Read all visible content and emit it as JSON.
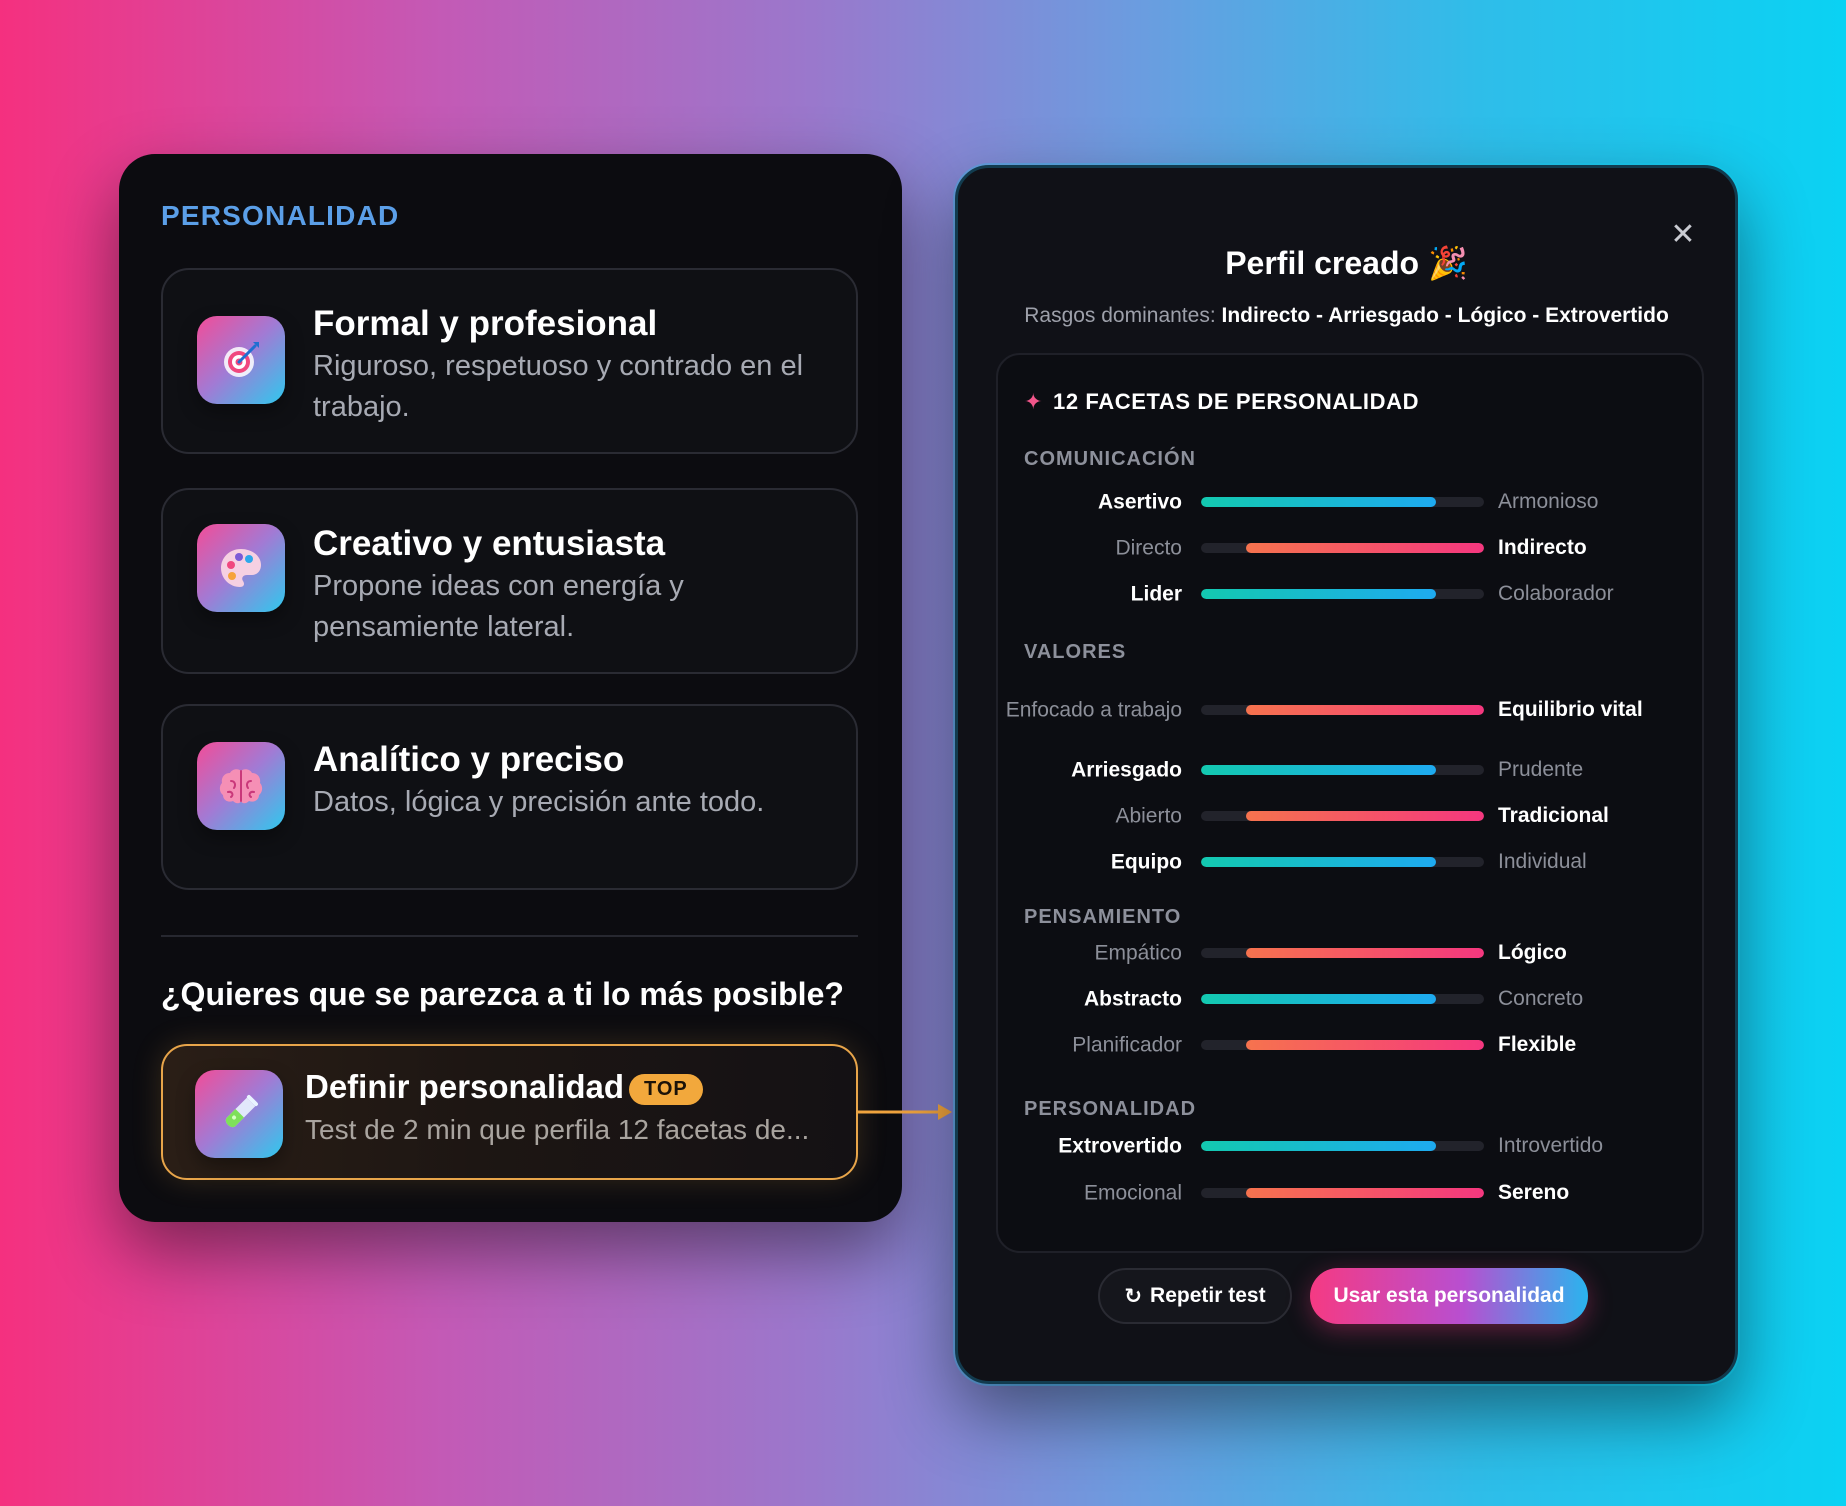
{
  "left_panel": {
    "title": "PERSONALIDAD",
    "options": [
      {
        "title": "Formal y profesional",
        "desc": "Riguroso, respetuoso y contrado en el trabajo.",
        "icon": "target-icon"
      },
      {
        "title": "Creativo y entusiasta",
        "desc": "Propone ideas con energía y pensamiente lateral.",
        "icon": "palette-icon"
      },
      {
        "title": "Analítico y preciso",
        "desc": "Datos, lógica y precisión ante todo.",
        "icon": "brain-icon"
      }
    ],
    "question": "¿Quieres que se parezca a ti lo más posible?",
    "define_card": {
      "title": "Definir personalidad",
      "badge": "TOP",
      "desc": "Test de 2 min que perfila 12 facetas de...",
      "icon": "test-tube-icon"
    }
  },
  "right_panel": {
    "close_icon": "close-icon",
    "title": "Perfil creado 🎉",
    "traits_prefix": "Rasgos dominantes:",
    "traits": "Indirecto - Arriesgado - Lógico - Extrovertido",
    "facets_title": "12 FACETAS DE PERSONALIDAD",
    "groups": [
      {
        "label": "COMUNICACIÓN",
        "facets": [
          {
            "left": "Asertivo",
            "right": "Armonioso",
            "dominant": "left",
            "level": 0.83
          },
          {
            "left": "Directo",
            "right": "Indirecto",
            "dominant": "right",
            "level": 0.84
          },
          {
            "left": "Lider",
            "right": "Colaborador",
            "dominant": "left",
            "level": 0.83
          }
        ]
      },
      {
        "label": "VALORES",
        "facets": [
          {
            "left": "Enfocado a trabajo",
            "right": "Equilibrio vital",
            "dominant": "right",
            "level": 0.84
          },
          {
            "left": "Arriesgado",
            "right": "Prudente",
            "dominant": "left",
            "level": 0.83
          },
          {
            "left": "Abierto",
            "right": "Tradicional",
            "dominant": "right",
            "level": 0.84
          },
          {
            "left": "Equipo",
            "right": "Individual",
            "dominant": "left",
            "level": 0.83
          }
        ]
      },
      {
        "label": "PENSAMIENTO",
        "facets": [
          {
            "left": "Empático",
            "right": "Lógico",
            "dominant": "right",
            "level": 0.84
          },
          {
            "left": "Abstracto",
            "right": "Concreto",
            "dominant": "left",
            "level": 0.83
          },
          {
            "left": "Planificador",
            "right": "Flexible",
            "dominant": "right",
            "level": 0.84
          }
        ]
      },
      {
        "label": "PERSONALIDAD",
        "facets": [
          {
            "left": "Extrovertido",
            "right": "Introvertido",
            "dominant": "left",
            "level": 0.83
          },
          {
            "left": "Emocional",
            "right": "Sereno",
            "dominant": "right",
            "level": 0.84
          }
        ]
      }
    ],
    "buttons": {
      "repeat": "Repetir test",
      "use": "Usar esta personalidad"
    }
  },
  "colors": {
    "accent_blue": "#5b9fe8",
    "badge_orange": "#f2a83c",
    "bar_left": "#1eaaf0",
    "bar_right": "#f5377f"
  }
}
